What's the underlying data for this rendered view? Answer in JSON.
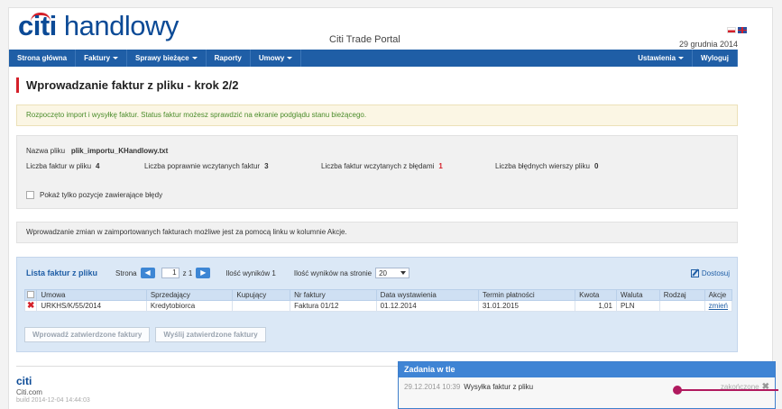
{
  "header": {
    "logo_part1": "citi",
    "logo_part2": " handlowy",
    "portal_name": "Citi Trade Portal",
    "date": "29 grudnia 2014"
  },
  "nav": {
    "items": [
      "Strona główna",
      "Faktury",
      "Sprawy bieżące",
      "Raporty",
      "Umowy"
    ],
    "right_items": [
      "Ustawienia",
      "Wyloguj"
    ]
  },
  "page": {
    "title": "Wprowadzanie faktur z pliku - krok 2/2",
    "notice": "Rozpoczęto import i wysyłkę faktur. Status faktur możesz sprawdzić na ekranie podglądu stanu bieżącego."
  },
  "file_info": {
    "file_label": "Nazwa pliku",
    "file_name": "plik_importu_KHandlowy.txt",
    "stats": [
      {
        "label": "Liczba faktur w pliku",
        "value": "4"
      },
      {
        "label": "Liczba poprawnie wczytanych faktur",
        "value": "3"
      },
      {
        "label": "Liczba faktur wczytanych z błędami",
        "value": "1"
      },
      {
        "label": "Liczba błędnych wierszy pliku",
        "value": "0"
      }
    ],
    "checkbox_label": "Pokaż tylko pozycje zawierające błędy"
  },
  "edit_note": "Wprowadzanie zmian w zaimportowanych fakturach możliwe jest za pomocą linku w kolumnie Akcje.",
  "invoice_list": {
    "title": "Lista faktur z pliku",
    "page_label": "Strona",
    "page_value": "1",
    "page_of": "z 1",
    "results_label": "Ilość wyników 1",
    "per_page_label": "Ilość wyników na stronie",
    "per_page_value": "20",
    "customize": "Dostosuj",
    "columns": [
      "Umowa",
      "Sprzedający",
      "Kupujący",
      "Nr faktury",
      "Data wystawienia",
      "Termin płatności",
      "Kwota",
      "Waluta",
      "Rodzaj",
      "Akcje"
    ],
    "rows": [
      {
        "umowa": "URKHS/K/55/2014",
        "sprzedajacy": "Kredytobiorca",
        "kupujacy": "",
        "nr": "Faktura 01/12",
        "data": "01.12.2014",
        "termin": "31.01.2015",
        "kwota": "1,01",
        "waluta": "PLN",
        "rodzaj": "",
        "akcja": "zmień"
      }
    ],
    "buttons": [
      "Wprowadź zatwierdzone faktury",
      "Wyślij zatwierdzone faktury"
    ]
  },
  "footer": {
    "logo": "citi",
    "text": "Citi.com",
    "build": "build 2014-12-04 14:44:03"
  },
  "tasks": {
    "title": "Zadania w tle",
    "time": "29.12.2014 10:39",
    "name": "Wysyłka faktur z pliku",
    "status": "zakończone"
  },
  "colors": {
    "brand_blue": "#1f5ea6",
    "accent_red": "#d4202a",
    "annotation": "#b0195e"
  }
}
